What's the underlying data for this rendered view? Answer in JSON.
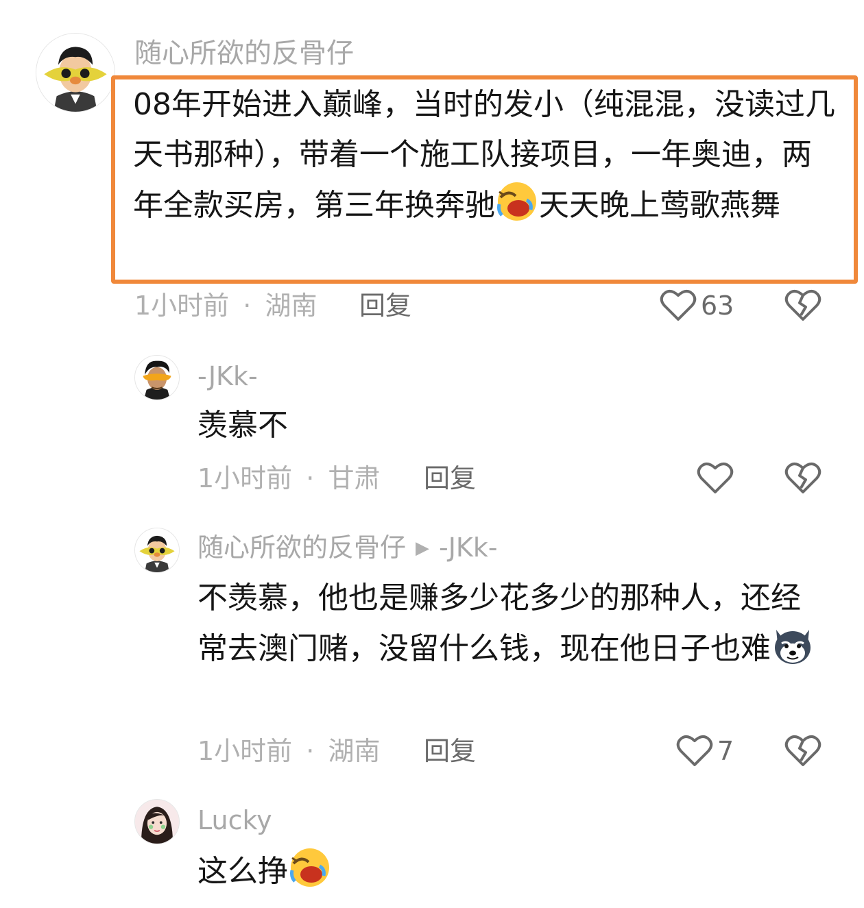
{
  "comments": [
    {
      "author": "随心所欲的反骨仔",
      "text_part1": "08年开始进入巅峰，当时的发小（纯混混，没读过几天书那种），带着一个施工队接项目，一年奥迪，两年全款买房，第三年换奔驰",
      "text_part2": "天天晚上莺歌燕舞",
      "emoji": "laughing-crying-face",
      "time": "1小时前",
      "location": "湖南",
      "separator": "·",
      "reply_label": "回复",
      "likes": "63",
      "highlight_color": "#f0883a"
    },
    {
      "author": "-JKk-",
      "text": "羡慕不",
      "time": "1小时前",
      "location": "甘肃",
      "separator": "·",
      "reply_label": "回复"
    },
    {
      "author": "随心所欲的反骨仔",
      "reply_to": "-JKk-",
      "text": "不羡慕，他也是赚多少花多少的那种人，还经常去澳门赌，没留什么钱，现在他日子也难",
      "emoji": "husky-dog-face",
      "time": "1小时前",
      "location": "湖南",
      "separator": "·",
      "reply_label": "回复",
      "likes": "7"
    },
    {
      "author": "Lucky",
      "text": "这么挣",
      "emoji": "laughing-crying-face"
    }
  ]
}
